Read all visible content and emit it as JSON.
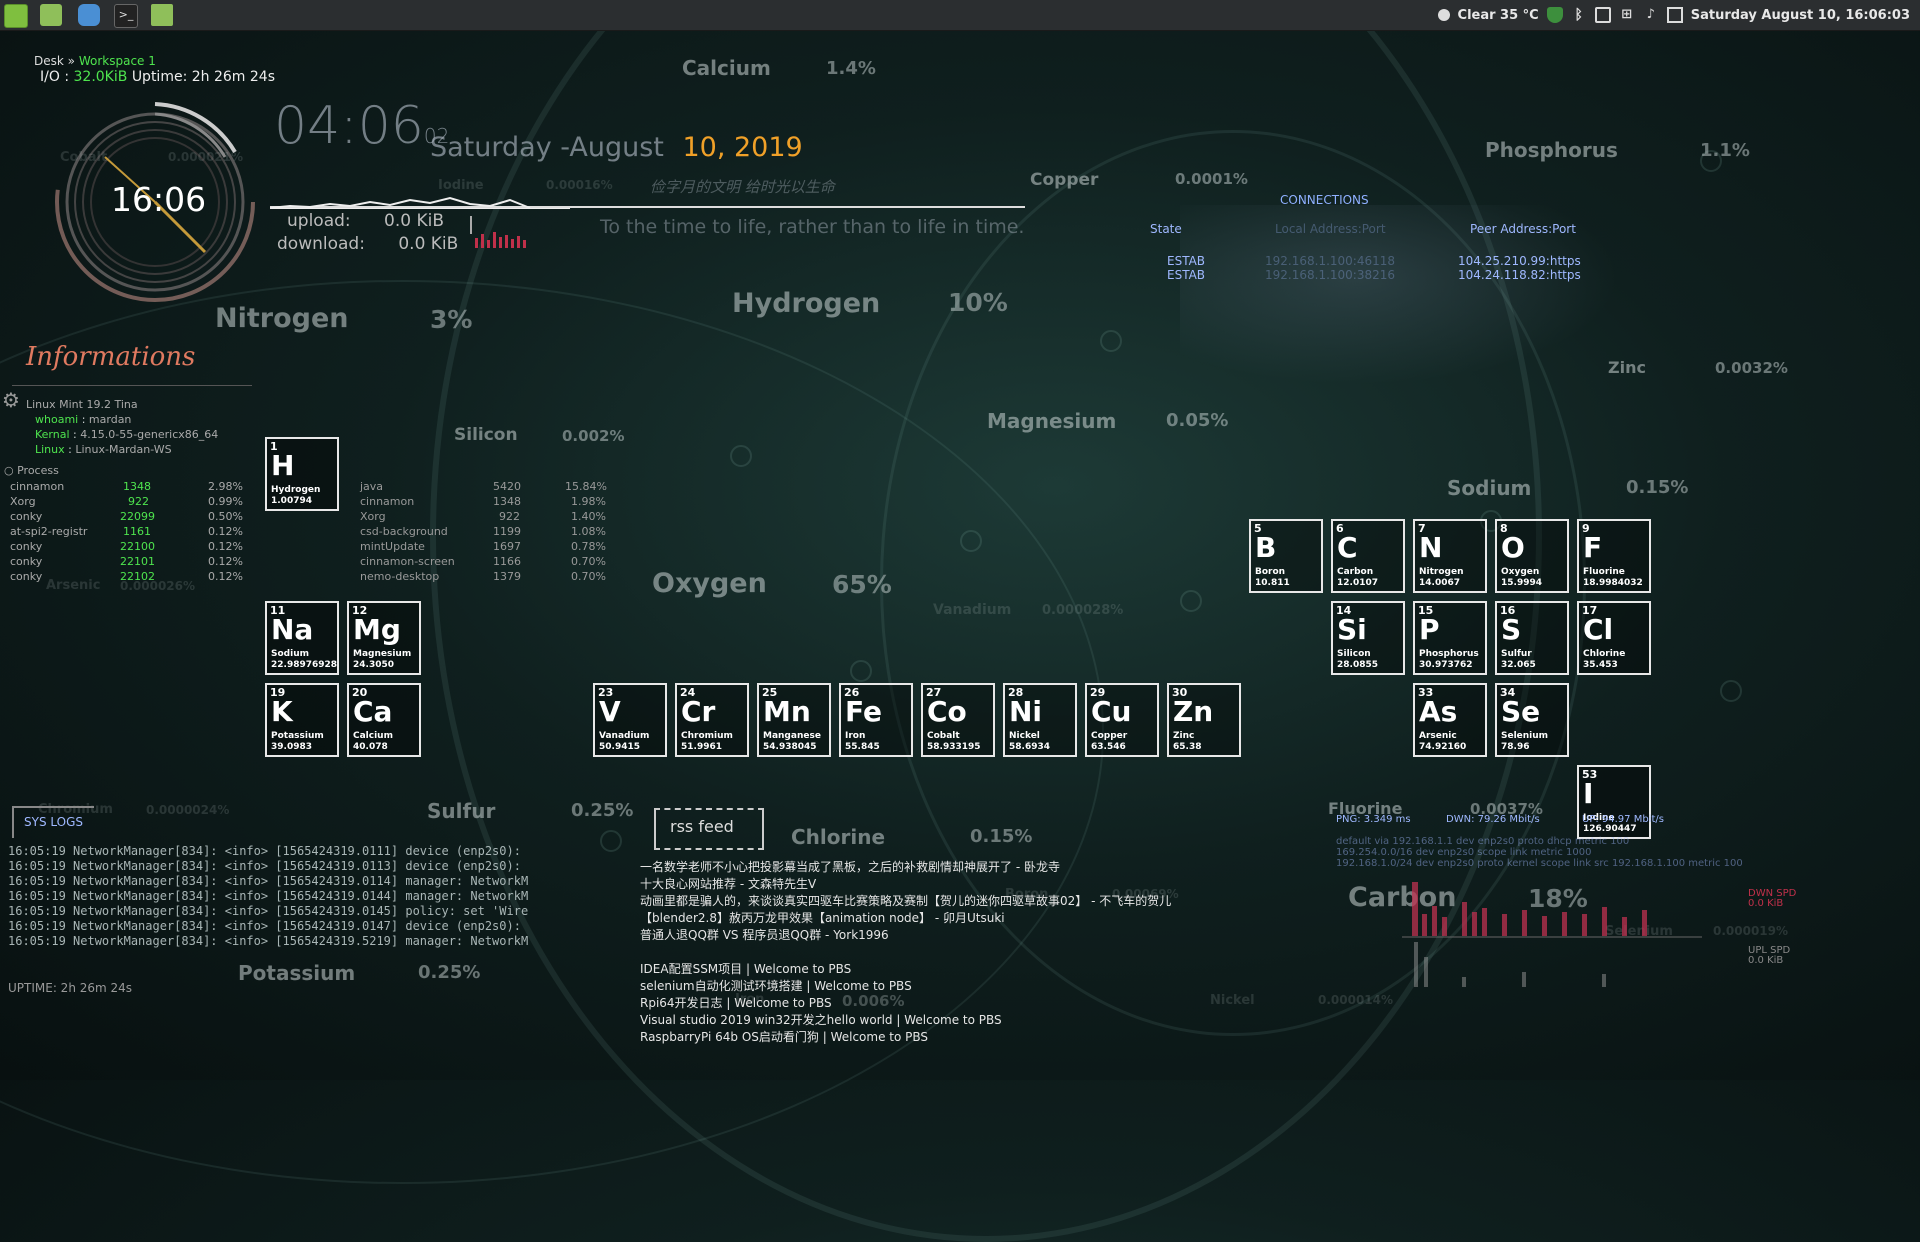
{
  "panel": {
    "weather": "Clear 35 °C",
    "datetime": "Saturday August 10, 16:06:03"
  },
  "conky_top": {
    "breadcrumb_desk": "Desk",
    "breadcrumb_sep": "»",
    "breadcrumb_ws": "Workspace 1",
    "io_label": "I/O :",
    "io_value": "32.0KiB",
    "uptime": "Uptime: 2h 26m 24s"
  },
  "clock": {
    "ring_time": "16:06",
    "big_time": "04:06",
    "big_seconds": "02",
    "date_prefix": "Saturday -August",
    "date_day": "10, 2019",
    "chinese_motto": "俭字月的文明 给时光以生命",
    "motto": "To the time to life, rather than to life in time."
  },
  "net": {
    "upload_label": "upload:",
    "upload_value": "0.0 KiB",
    "download_label": "download:",
    "download_value": "0.0 KiB"
  },
  "connections": {
    "title": "CONNECTIONS",
    "col_state": "State",
    "col_local": "Local Address:Port",
    "col_peer": "Peer Address:Port",
    "rows": [
      {
        "state": "ESTAB",
        "local": "192.168.1.100:46118",
        "peer": "104.25.210.99:https"
      },
      {
        "state": "ESTAB",
        "local": "192.168.1.100:38216",
        "peer": "104.24.118.82:https"
      }
    ]
  },
  "info": {
    "title": "Informations",
    "os": "Linux Mint 19.2 Tina",
    "whoami_label": "whoami",
    "whoami": "mardan",
    "kernel_label": "Kernal",
    "kernel": "4.15.0-55-genericx86_64",
    "linux_label": "Linux",
    "host": "Linux-Mardan-WS",
    "process_title": "Process",
    "processes_cpu": [
      {
        "name": "cinnamon",
        "pid": "1348",
        "pct": "2.98%"
      },
      {
        "name": "Xorg",
        "pid": "922",
        "pct": "0.99%"
      },
      {
        "name": "conky",
        "pid": "22099",
        "pct": "0.50%"
      },
      {
        "name": "at-spi2-registr",
        "pid": "1161",
        "pct": "0.12%"
      },
      {
        "name": "conky",
        "pid": "22100",
        "pct": "0.12%"
      },
      {
        "name": "conky",
        "pid": "22101",
        "pct": "0.12%"
      },
      {
        "name": "conky",
        "pid": "22102",
        "pct": "0.12%"
      }
    ],
    "processes_mem": [
      {
        "name": "java",
        "pid": "5420",
        "pct": "15.84%"
      },
      {
        "name": "cinnamon",
        "pid": "1348",
        "pct": "1.98%"
      },
      {
        "name": "Xorg",
        "pid": "922",
        "pct": "1.40%"
      },
      {
        "name": "csd-background",
        "pid": "1199",
        "pct": "1.08%"
      },
      {
        "name": "mintUpdate",
        "pid": "1697",
        "pct": "0.78%"
      },
      {
        "name": "cinnamon-screen",
        "pid": "1166",
        "pct": "0.70%"
      },
      {
        "name": "nemo-desktop",
        "pid": "1379",
        "pct": "0.70%"
      }
    ]
  },
  "bg_elements": [
    {
      "name": "Calcium",
      "pct": "1.4%"
    },
    {
      "name": "Phosphorus",
      "pct": "1.1%"
    },
    {
      "name": "Copper",
      "pct": "0.0001%"
    },
    {
      "name": "Hydrogen",
      "pct": "10%"
    },
    {
      "name": "Nitrogen",
      "pct": "3%"
    },
    {
      "name": "Zinc",
      "pct": "0.0032%"
    },
    {
      "name": "Magnesium",
      "pct": "0.05%"
    },
    {
      "name": "Silicon",
      "pct": "0.002%"
    },
    {
      "name": "Sodium",
      "pct": "0.15%"
    },
    {
      "name": "Oxygen",
      "pct": "65%"
    },
    {
      "name": "Vanadium",
      "pct": "0.000028%"
    },
    {
      "name": "Sulfur",
      "pct": "0.25%"
    },
    {
      "name": "Chlorine",
      "pct": "0.15%"
    },
    {
      "name": "Fluorine",
      "pct": "0.0037%"
    },
    {
      "name": "Carbon",
      "pct": "18%"
    },
    {
      "name": "Potassium",
      "pct": "0.25%"
    },
    {
      "name": "Chromium",
      "pct": "0.0000024%"
    },
    {
      "name": "Arsenic",
      "pct": "0.000026%"
    },
    {
      "name": "Cobalt",
      "pct": "0.000021%"
    },
    {
      "name": "Iodine",
      "pct": "0.00016%"
    },
    {
      "name": "Selenium",
      "pct": "0.000019%"
    },
    {
      "name": "Nickel",
      "pct": "0.000014%"
    },
    {
      "name": "Boron",
      "pct": "0.00069%"
    },
    {
      "name": "Iron",
      "pct": "0.006%"
    }
  ],
  "tiles": [
    {
      "num": "1",
      "sym": "H",
      "name": "Hydrogen",
      "wt": "1.00794"
    },
    {
      "num": "11",
      "sym": "Na",
      "name": "Sodium",
      "wt": "22.98976928"
    },
    {
      "num": "12",
      "sym": "Mg",
      "name": "Magnesium",
      "wt": "24.3050"
    },
    {
      "num": "19",
      "sym": "K",
      "name": "Potassium",
      "wt": "39.0983"
    },
    {
      "num": "20",
      "sym": "Ca",
      "name": "Calcium",
      "wt": "40.078"
    },
    {
      "num": "23",
      "sym": "V",
      "name": "Vanadium",
      "wt": "50.9415"
    },
    {
      "num": "24",
      "sym": "Cr",
      "name": "Chromium",
      "wt": "51.9961"
    },
    {
      "num": "25",
      "sym": "Mn",
      "name": "Manganese",
      "wt": "54.938045"
    },
    {
      "num": "26",
      "sym": "Fe",
      "name": "Iron",
      "wt": "55.845"
    },
    {
      "num": "27",
      "sym": "Co",
      "name": "Cobalt",
      "wt": "58.933195"
    },
    {
      "num": "28",
      "sym": "Ni",
      "name": "Nickel",
      "wt": "58.6934"
    },
    {
      "num": "29",
      "sym": "Cu",
      "name": "Copper",
      "wt": "63.546"
    },
    {
      "num": "30",
      "sym": "Zn",
      "name": "Zinc",
      "wt": "65.38"
    },
    {
      "num": "5",
      "sym": "B",
      "name": "Boron",
      "wt": "10.811"
    },
    {
      "num": "6",
      "sym": "C",
      "name": "Carbon",
      "wt": "12.0107"
    },
    {
      "num": "7",
      "sym": "N",
      "name": "Nitrogen",
      "wt": "14.0067"
    },
    {
      "num": "8",
      "sym": "O",
      "name": "Oxygen",
      "wt": "15.9994"
    },
    {
      "num": "9",
      "sym": "F",
      "name": "Fluorine",
      "wt": "18.9984032"
    },
    {
      "num": "14",
      "sym": "Si",
      "name": "Silicon",
      "wt": "28.0855"
    },
    {
      "num": "15",
      "sym": "P",
      "name": "Phosphorus",
      "wt": "30.973762"
    },
    {
      "num": "16",
      "sym": "S",
      "name": "Sulfur",
      "wt": "32.065"
    },
    {
      "num": "17",
      "sym": "Cl",
      "name": "Chlorine",
      "wt": "35.453"
    },
    {
      "num": "33",
      "sym": "As",
      "name": "Arsenic",
      "wt": "74.92160"
    },
    {
      "num": "34",
      "sym": "Se",
      "name": "Selenium",
      "wt": "78.96"
    },
    {
      "num": "53",
      "sym": "I",
      "name": "Iodine",
      "wt": "126.90447"
    }
  ],
  "syslog": {
    "title": "SYS LOGS",
    "lines": [
      "16:05:19  NetworkManager[834]: <info> [1565424319.0111] device (enp2s0):",
      "16:05:19  NetworkManager[834]: <info> [1565424319.0113] device (enp2s0):",
      "16:05:19  NetworkManager[834]: <info> [1565424319.0114] manager: NetworkM",
      "16:05:19  NetworkManager[834]: <info> [1565424319.0144] manager: NetworkM",
      "16:05:19  NetworkManager[834]: <info> [1565424319.0145] policy: set 'Wire",
      "16:05:19  NetworkManager[834]: <info> [1565424319.0147] device (enp2s0):",
      "16:05:19  NetworkManager[834]: <info> [1565424319.5219] manager: NetworkM"
    ],
    "uptime": "UPTIME: 2h 26m 24s"
  },
  "rss": {
    "title": "rss feed",
    "items_group1": [
      "一名数学老师不小心把投影幕当成了黑板，之后的补救剧情却神展开了 - 卧龙寺",
      "十大良心网站推荐 - 文森特先生V",
      "动画里都是骗人的，来谈谈真实四驱车比赛策略及赛制【贺儿的迷你四驱草故事02】 - 不飞车的贺儿",
      "【blender2.8】赦丙万龙甲效果【animation node】 - 卯月Utsuki",
      "普通人退QQ群 VS 程序员退QQ群 - York1996"
    ],
    "items_group2": [
      "IDEA配置SSM项目 | Welcome to PBS",
      "selenium自动化测试环境搭建 | Welcome to PBS",
      "Rpi64开发日志 | Welcome to PBS",
      "Visual studio 2019 win32开发之hello world | Welcome to PBS",
      "RaspbarryPi 64b OS启动看门狗 | Welcome to PBS"
    ]
  },
  "netstat": {
    "ping": "PNG: 3.349 ms",
    "down": "DWN: 79.26 Mbit/s",
    "up": "UP: 94.97 Mbit/s",
    "route1": "default via 192.168.1.1 dev enp2s0 proto dhcp metric 100",
    "route2": "169.254.0.0/16 dev enp2s0 scope link metric 1000",
    "route3": "192.168.1.0/24 dev enp2s0 proto kernel scope link src 192.168.1.100 metric 100",
    "dwn_spd": "DWN SPD",
    "dwn_val": "0.0 KiB",
    "upl_spd": "UPL SPD",
    "upl_val": "0.0 KiB"
  }
}
